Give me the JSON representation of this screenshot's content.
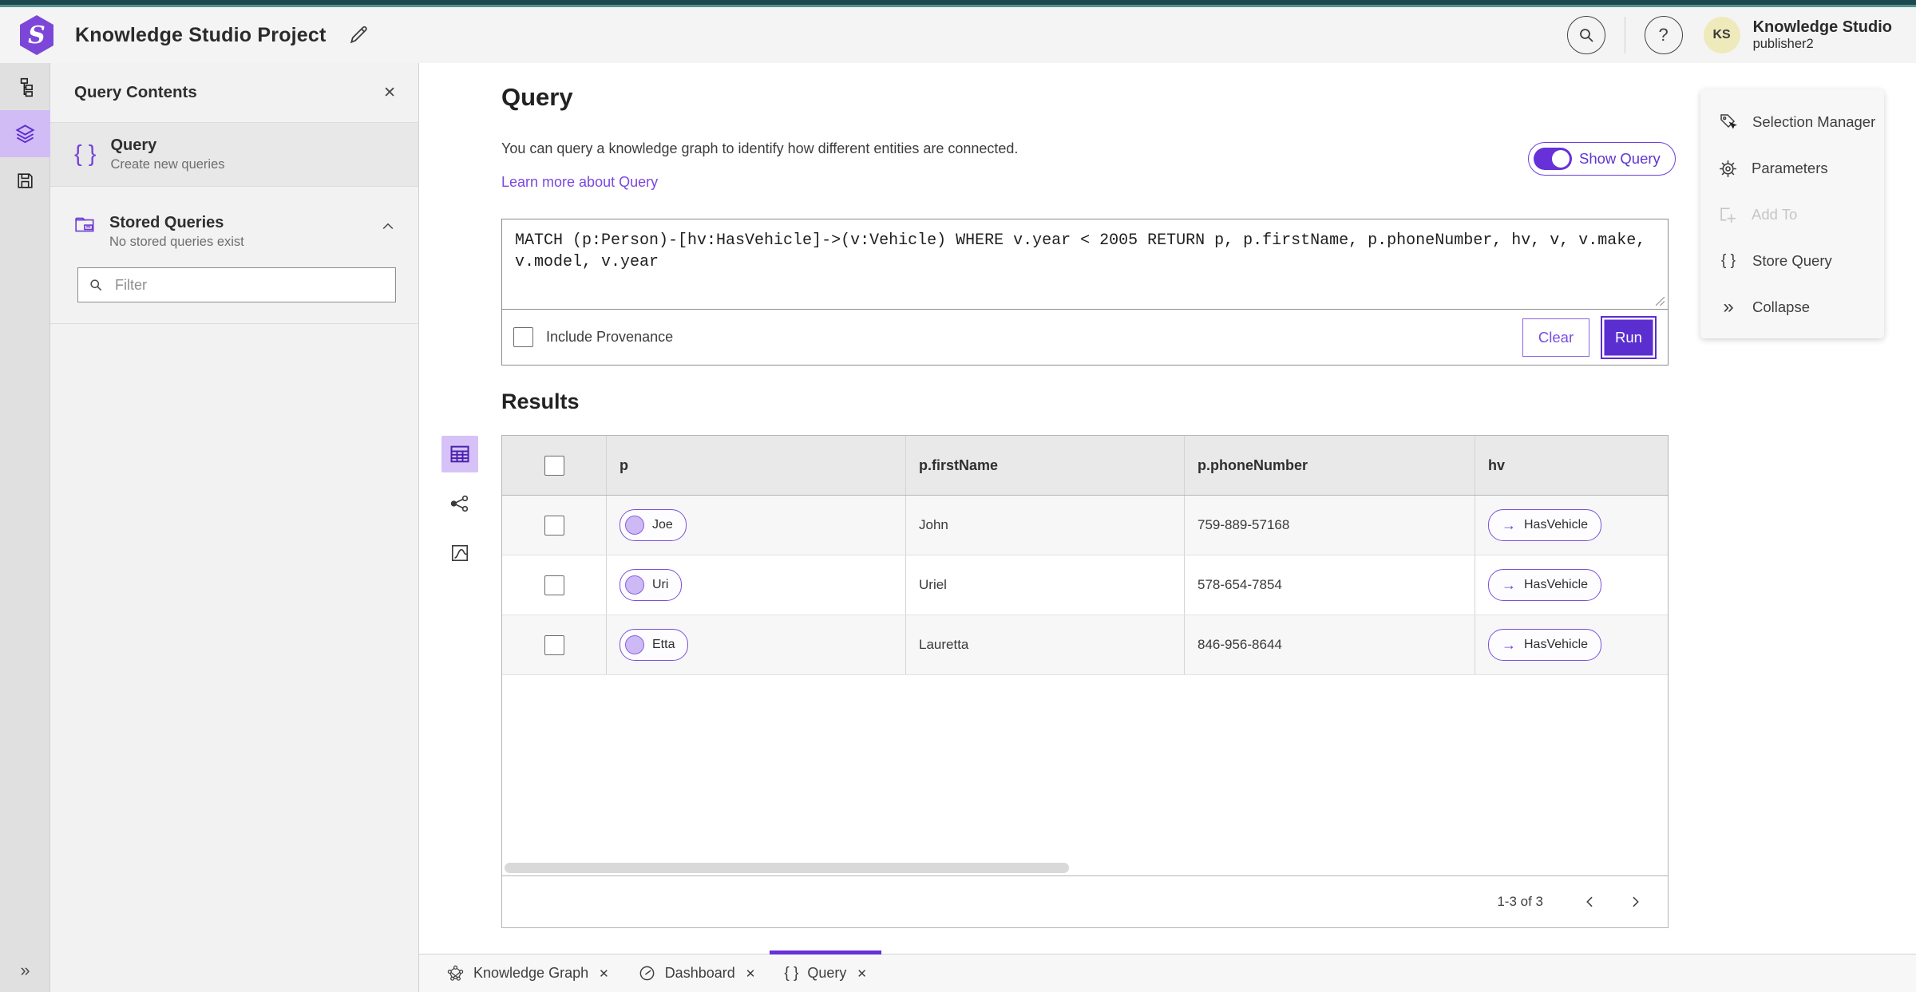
{
  "app": {
    "title": "Knowledge Studio Project",
    "user": {
      "initials": "KS",
      "name": "Knowledge Studio",
      "role": "publisher2"
    }
  },
  "colors": {
    "accent_purple": "#6730d9",
    "accent_light_purple": "#d2bcf6",
    "run_button_purple": "#5b2ed0",
    "top_strip_teal": "#1d484e",
    "avatar_yellow": "#efeabc"
  },
  "icons": {
    "braces": "{ }",
    "close": "✕",
    "collapse_chevrons": "»",
    "expand_chevrons": "»",
    "arrow_right": "→",
    "chevron_left": "‹",
    "chevron_right": "›"
  },
  "sidebar": {
    "panel_title": "Query Contents",
    "query_item": {
      "title": "Query",
      "subtitle": "Create new queries"
    },
    "stored_item": {
      "title": "Stored Queries",
      "subtitle": "No stored queries exist"
    },
    "filter_placeholder": "Filter"
  },
  "query": {
    "heading": "Query",
    "description": "You can query a knowledge graph to identify how different entities are connected.",
    "learn_more": "Learn more about Query",
    "show_query_label": "Show Query",
    "text": "MATCH (p:Person)-[hv:HasVehicle]->(v:Vehicle) WHERE v.year < 2005 RETURN p, p.firstName, p.phoneNumber, hv, v, v.make, v.model, v.year",
    "include_provenance_label": "Include Provenance",
    "clear_label": "Clear",
    "run_label": "Run"
  },
  "results": {
    "heading": "Results",
    "columns": [
      "p",
      "p.firstName",
      "p.phoneNumber",
      "hv"
    ],
    "rows": [
      {
        "p": "Joe",
        "firstName": "John",
        "phoneNumber": "759-889-57168",
        "hv": "HasVehicle"
      },
      {
        "p": "Uri",
        "firstName": "Uriel",
        "phoneNumber": "578-654-7854",
        "hv": "HasVehicle"
      },
      {
        "p": "Etta",
        "firstName": "Lauretta",
        "phoneNumber": "846-956-8644",
        "hv": "HasVehicle"
      }
    ],
    "pagination": {
      "range": "1-3 of 3"
    }
  },
  "right_panel": {
    "items": [
      {
        "label": "Selection Manager"
      },
      {
        "label": "Parameters"
      },
      {
        "label": "Add To"
      },
      {
        "label": "Store Query"
      },
      {
        "label": "Collapse"
      }
    ]
  },
  "tabs": [
    {
      "label": "Knowledge Graph"
    },
    {
      "label": "Dashboard"
    },
    {
      "label": "Query"
    }
  ]
}
